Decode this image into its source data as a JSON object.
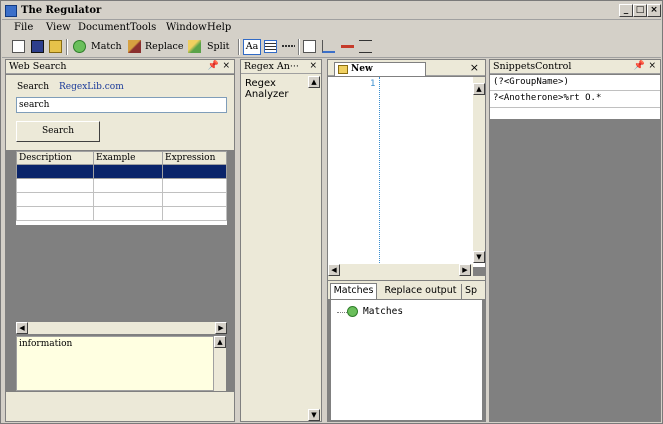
{
  "window": {
    "title": "The Regulator",
    "controls": [
      "_",
      "□",
      "×"
    ]
  },
  "menu": [
    "File",
    "View",
    "Document",
    "Tools",
    "Window",
    "Help"
  ],
  "toolbar": {
    "match_label": "Match",
    "replace_label": "Replace",
    "split_label": "Split",
    "aa_label": "Aa"
  },
  "web_search": {
    "title": "Web Search",
    "search_label": "Search",
    "site_link": "RegexLib.com",
    "search_value": "search",
    "search_button": "Search",
    "columns": [
      "Description",
      "Example",
      "Expression"
    ],
    "info_label": "information"
  },
  "regex_analyzer": {
    "title": "Regex An···",
    "content": "Regex Analyzer"
  },
  "editor": {
    "tab_label": "New Document",
    "line_number": "1"
  },
  "output_tabs": {
    "tabs": [
      "Matches",
      "Replace output",
      "Sp"
    ],
    "tree_root": "Matches"
  },
  "snippets": {
    "title": "SnippetsControl",
    "items": [
      "(?<GroupName>)",
      "?<Anotherone>%rt O.*"
    ]
  },
  "colors": {
    "selected_row": "#0a246a",
    "accent": "#3b6fc9",
    "info_bg": "#ffffe1"
  }
}
